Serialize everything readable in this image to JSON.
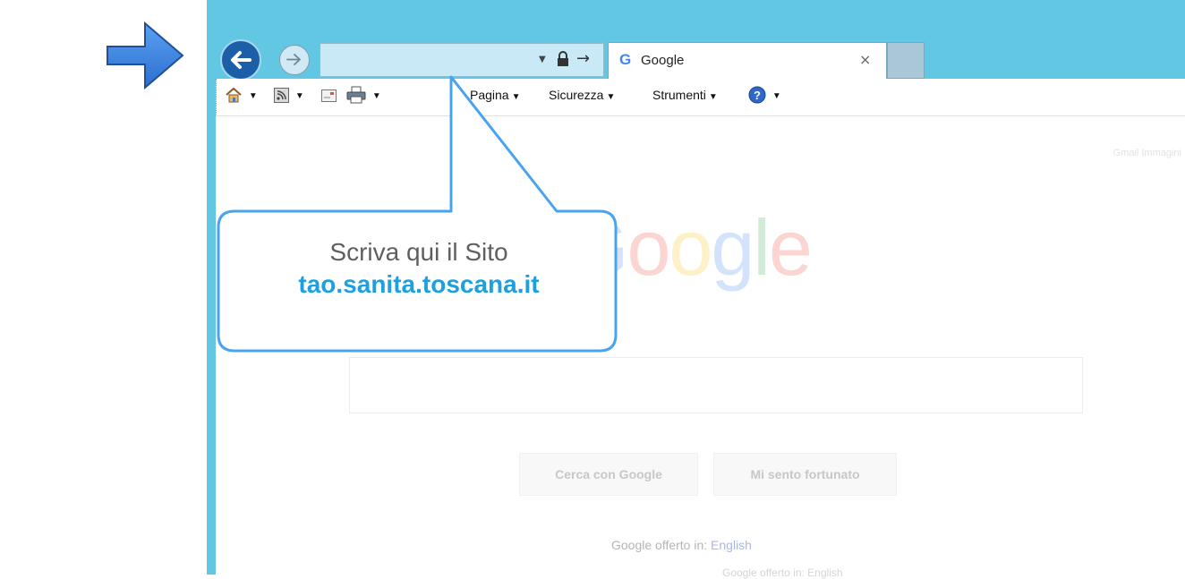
{
  "browser": {
    "address_value": "",
    "tab": {
      "favicon": "G",
      "title": "Google",
      "close_glyph": "×"
    },
    "buttons": {
      "back_icon": "back-arrow-icon",
      "forward_icon": "forward-arrow-icon"
    },
    "colors": {
      "frame": "#62c7e3",
      "back_button": "#1c5fa8",
      "address_bar": "#c9e9f6"
    }
  },
  "toolbar": {
    "home_drop": "▼",
    "feeds_drop": "▼",
    "print_drop": "▼",
    "pagina": "Pagina",
    "sicurezza": "Sicurezza",
    "strumenti": "Strumenti",
    "help_drop": "▼",
    "drop": "▼"
  },
  "google": {
    "logo": {
      "l1": "G",
      "l2": "o",
      "l3": "o",
      "l4": "g",
      "l5": "l",
      "l6": "e"
    },
    "search_button": "Cerca con Google",
    "lucky_button": "Mi sento fortunato",
    "offered_in": "Google offerto in:",
    "language_link": "English",
    "bottom_text": "Google offerto in: English",
    "top_right": "Gmail  Immagini"
  },
  "callout": {
    "line1": "Scriva qui il Sito",
    "line2": "tao.sanita.toscana.it",
    "color_border": "#4aa3ef",
    "color_url": "#1ea0e0"
  }
}
